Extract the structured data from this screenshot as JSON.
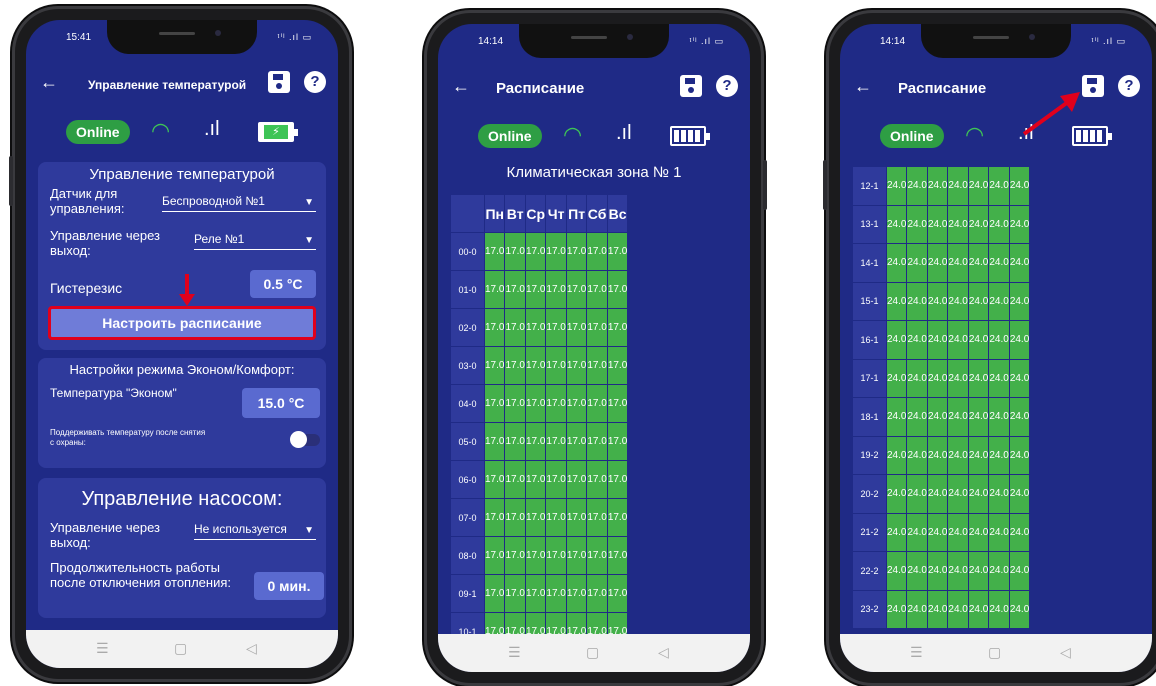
{
  "phone1": {
    "time": "15:41",
    "status_icons": "ᵗⁱˡ .ıl ▭",
    "title": "Управление температурой",
    "online": "Online",
    "temp_card": {
      "header": "Управление температурой",
      "sensor_label": "Датчик для управления:",
      "sensor_value": "Беспроводной №1",
      "output_label": "Управление через выход:",
      "output_value": "Реле №1",
      "hysteresis_label": "Гистерезис",
      "hysteresis_value": "0.5 °C",
      "schedule_button": "Настроить расписание"
    },
    "eco_card": {
      "header": "Настройки режима Эконом/Комфорт:",
      "eco_label": "Температура \"Эконом\"",
      "eco_value": "15.0 °C",
      "keep_label": "Поддерживать температуру после снятия с охраны:"
    },
    "pump_card": {
      "header": "Управление насосом:",
      "output_label": "Управление через выход:",
      "output_value": "Не используется",
      "duration_label": "Продолжительность работы после отключения отопления:",
      "duration_value": "0 мин."
    }
  },
  "phone2": {
    "time": "14:14",
    "status_icons": "ᵗⁱˡ .ıl ▭",
    "title": "Расписание",
    "online": "Online",
    "zone": "Климатическая зона № 1",
    "days": [
      "Пн",
      "Вт",
      "Ср",
      "Чт",
      "Пт",
      "Сб",
      "Вс"
    ],
    "rows": [
      "00-0",
      "01-0",
      "02-0",
      "03-0",
      "04-0",
      "05-0",
      "06-0",
      "07-0",
      "08-0",
      "09-1",
      "10-1"
    ],
    "value": "17.0"
  },
  "phone3": {
    "time": "14:14",
    "status_icons": "ᵗⁱˡ .ıl ▭",
    "title": "Расписание",
    "online": "Online",
    "rows": [
      "12-1",
      "13-1",
      "14-1",
      "15-1",
      "16-1",
      "17-1",
      "18-1",
      "19-2",
      "20-2",
      "21-2",
      "22-2",
      "23-2"
    ],
    "value": "24.0"
  },
  "navbar": {
    "menu": "☰",
    "home": "▢",
    "back": "◁"
  },
  "colors": {
    "app_bg": "#1f2a86",
    "card": "#2f3a9c",
    "cell_green": "#43b04a",
    "online_green": "#2e9e44",
    "highlight_red": "#e0001c"
  }
}
